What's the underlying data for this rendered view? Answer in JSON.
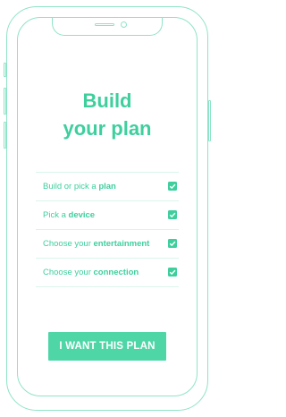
{
  "colors": {
    "accent": "#3ecf9d",
    "button": "#4fd6a7",
    "outline": "#8fe3c8"
  },
  "heading": {
    "line1": "Build",
    "line2": "your plan"
  },
  "steps": [
    {
      "prefix": "Build or pick a ",
      "bold": "plan",
      "checked": true,
      "icon": "checkbox-checked-icon"
    },
    {
      "prefix": "Pick a ",
      "bold": "device",
      "checked": true,
      "icon": "checkbox-checked-icon"
    },
    {
      "prefix": "Choose your ",
      "bold": "entertainment",
      "checked": true,
      "icon": "checkbox-checked-icon"
    },
    {
      "prefix": "Choose your ",
      "bold": "connection",
      "checked": true,
      "icon": "checkbox-checked-icon"
    }
  ],
  "cta": {
    "label": "I WANT THIS PLAN"
  }
}
